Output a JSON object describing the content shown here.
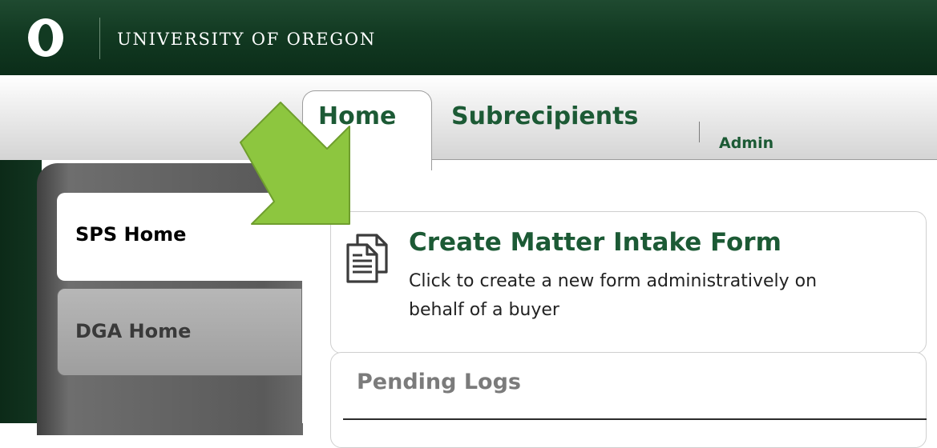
{
  "header": {
    "logo_icon": "oregon-o-logo",
    "title": "UNIVERSITY OF OREGON",
    "brand_color": "#154733"
  },
  "nav": {
    "tabs": [
      {
        "label": "Home",
        "active": true
      },
      {
        "label": "Subrecipients",
        "active": false
      },
      {
        "label": "Admin",
        "active": false
      }
    ]
  },
  "sidebar": {
    "items": [
      {
        "label": "SPS Home",
        "active": true
      },
      {
        "label": "DGA Home",
        "active": false
      }
    ]
  },
  "main": {
    "create_card": {
      "icon": "document-copy-icon",
      "title": "Create Matter Intake Form",
      "description_line1": "Click to create a new form administratively on",
      "description_line2": "behalf of a buyer"
    },
    "pending_card": {
      "title": "Pending Logs"
    }
  },
  "annotation": {
    "icon": "arrow-pointer-icon",
    "color": "#8dc63f"
  }
}
